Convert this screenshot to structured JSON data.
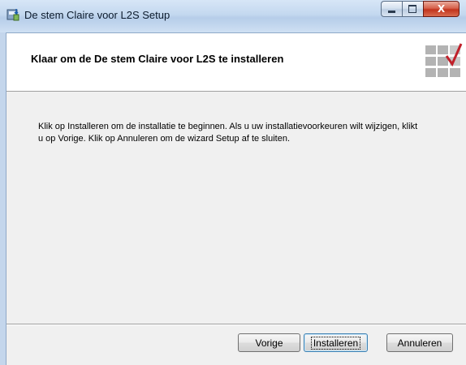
{
  "window": {
    "title": "De stem Claire voor L2S Setup",
    "icon": "installer-icon",
    "controls": {
      "minimize": "minimize-icon",
      "maximize": "maximize-icon",
      "close": "X"
    }
  },
  "header": {
    "title": "Klaar om de De stem Claire voor L2S te installeren",
    "icon": "setup-checkmark-icon",
    "accent_color": "#c0202a"
  },
  "body": {
    "text": "Klik op Installeren om de installatie te beginnen. Als u uw installatievoorkeuren wilt wijzigen, klikt u op Vorige. Klik op Annuleren om de wizard Setup af te sluiten."
  },
  "buttons": {
    "back": "Vorige",
    "install": "Installeren",
    "cancel": "Annuleren"
  }
}
